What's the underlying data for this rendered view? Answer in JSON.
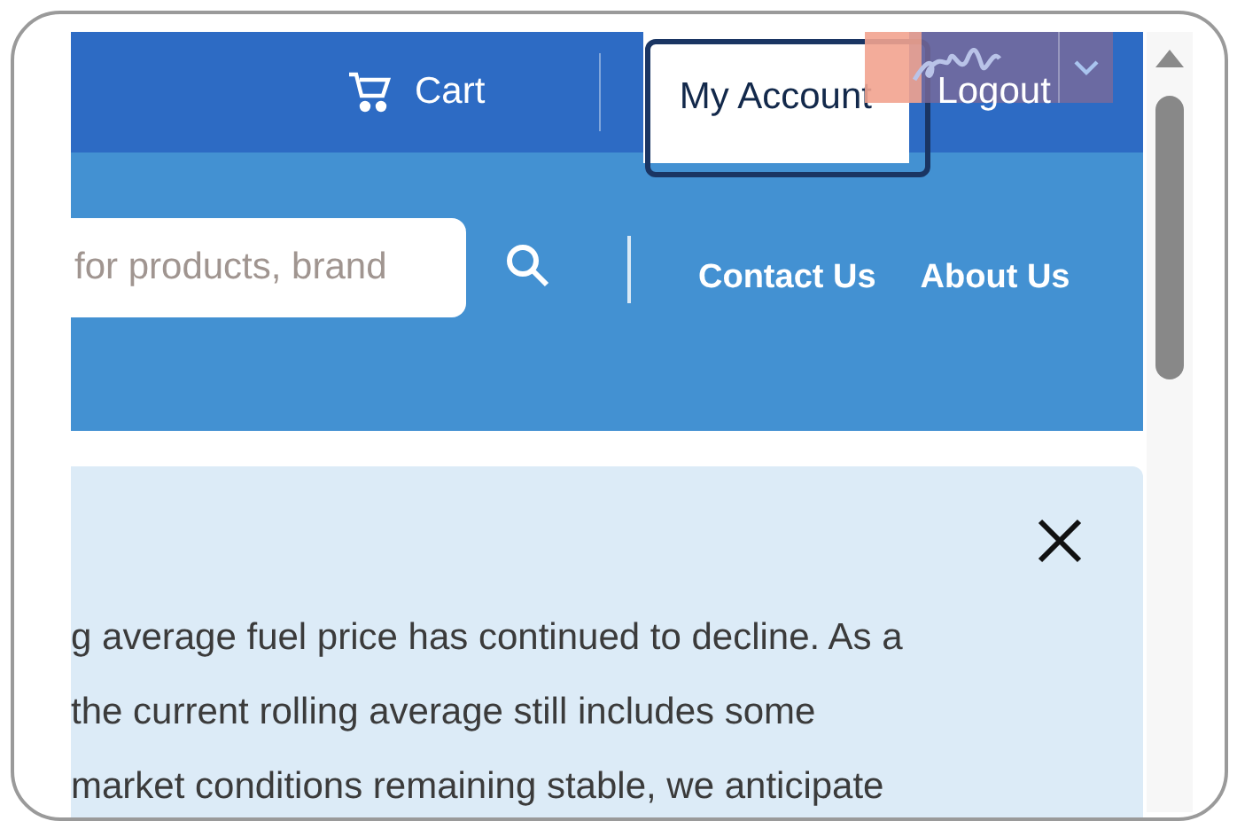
{
  "top_bar": {
    "cart": "Cart",
    "account": {
      "label": "My Account",
      "focused": true
    },
    "logout": "Logout"
  },
  "nav_bar": {
    "search": {
      "placeholder": "for products, brand"
    },
    "links": [
      "Contact Us",
      "About Us"
    ]
  },
  "notice": {
    "lines": [
      "g average fuel price has continued to decline. As a",
      "the current rolling average still includes some",
      "market conditions remaining stable, we anticipate"
    ]
  }
}
